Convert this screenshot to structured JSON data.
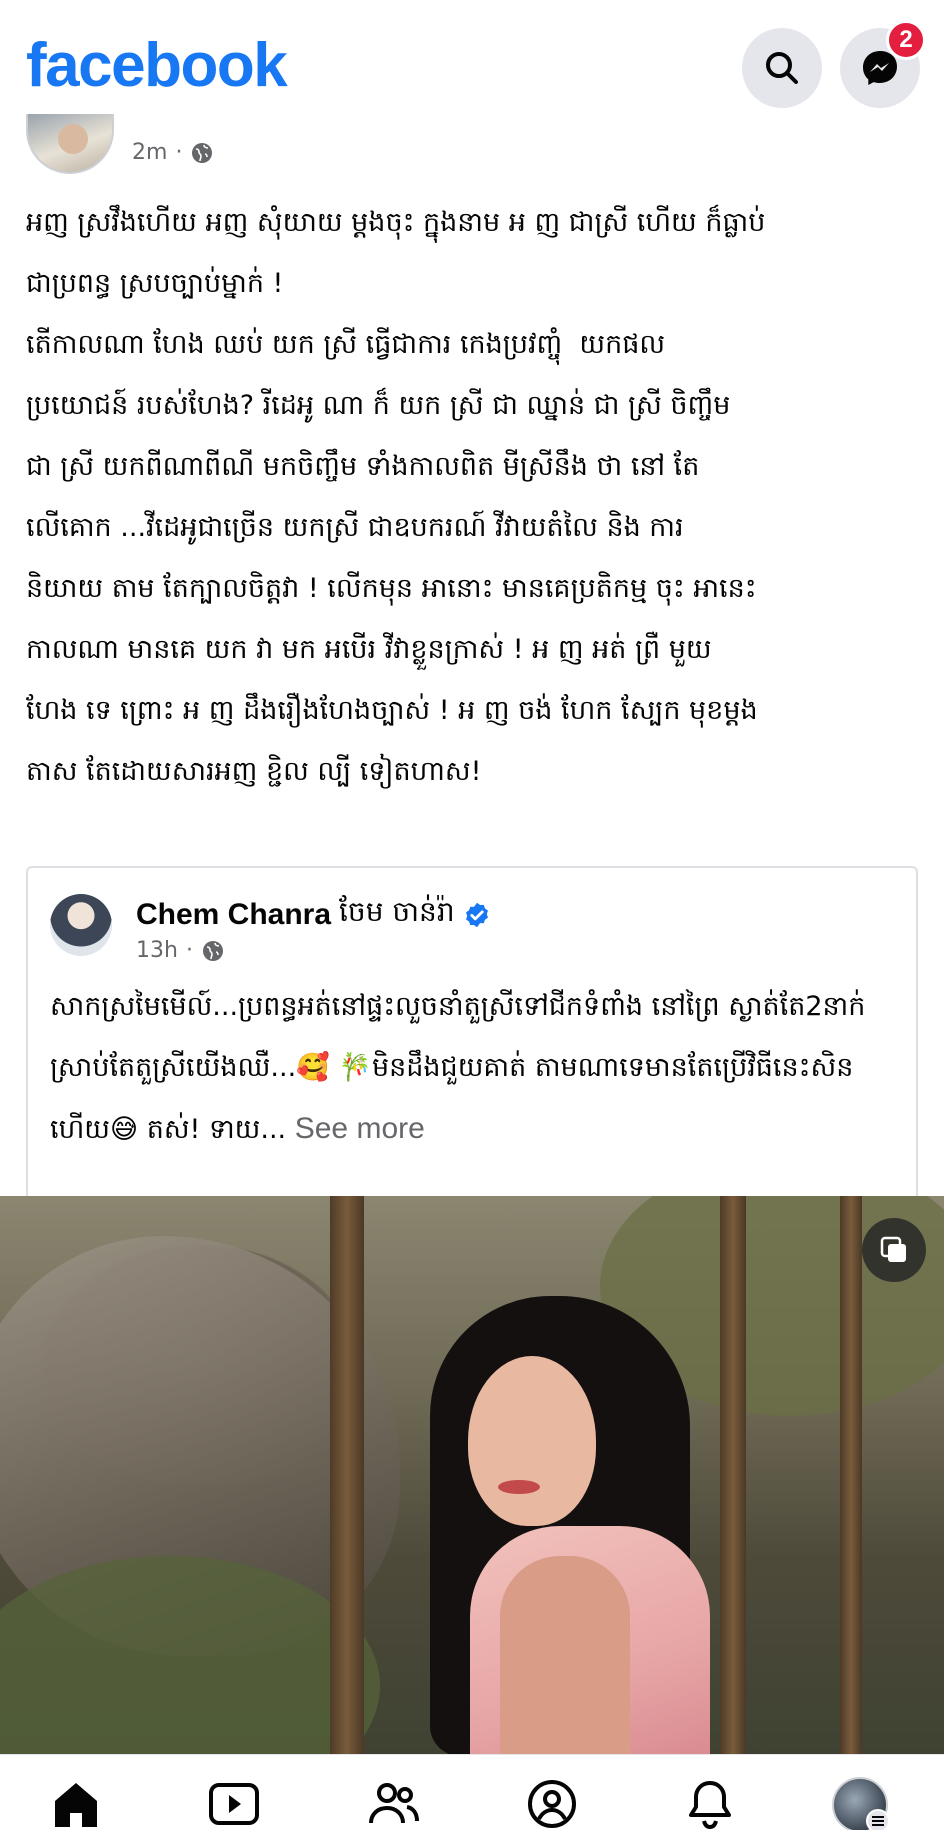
{
  "header": {
    "logo": "facebook",
    "messenger_badge": "2"
  },
  "post": {
    "time": "2m",
    "text": "អញ ស្រវឹងហើយ អញ សុំយាយ ម្តងចុះ ក្នុងនាម អ ញ ជាស្រី ហើយ ក៏ធ្លាប់\nជាប្រពន្ធ ស្របច្បាប់ម្នាក់ !\nតើកាលណា ហែង ឈប់ យក ស្រី ធ្វើជាការ កេងប្រវញ្ចុំ  យកផល\nប្រយោជន៍ របស់ហែង? រីដេអូ ណា ក៏ យក ស្រី ជា ឈ្នាន់ ជា ស្រី ចិញ្ចឹម\nជា ស្រី យកពីណាពីណី មកចិញ្ចឹម ទាំងកាលពិត មីស្រីនឹង ថា នៅ តែ\nលើគោក ...វីដេអូជាច្រើន យកស្រី ជាឧបករណ៍ វីវាយតំលៃ និង ការ\nនិយាយ តាម តែក្បាលចិត្តវា ! លើកមុន អានោះ មានគេប្រតិកម្ម ចុះ អានេះ\nកាលណា មានគេ យក វា មក អបើរ វីវាខ្លួនក្រាស់ ! អ ញ អត់ ព្រឺ មួយ\nហែង ទេ ព្រោះ អ ញ ដឹងរឿងហែងច្បាស់ ! អ ញ ចង់ ហែក ស្បែក មុខម្តង\nតាស តែដោយសារអញ ខ្ជិល ល្បី ទៀតហាស!"
  },
  "shared_post": {
    "author": "Chem Chanra",
    "author_khmer": "ចែម ចាន់រ៉ា",
    "time": "13h",
    "text": "សាកស្រមៃមើល៍...ប្រពន្ធអត់នៅផ្ទះលួចនាំតួស្រីទៅជីកទំពាំង នៅព្រៃ ស្ងាត់តែ2នាក់ ស្រាប់តែតួស្រីយើងឈឺ...🥰 🎋មិនដឹងជួយគាត់ តាមណាទេមានតែប្រើវិធីនេះសិនហើយ😅 តស់! ទាយ...",
    "see_more": "See more"
  },
  "icons": {
    "search": "search-icon",
    "messenger": "messenger-icon",
    "globe": "globe-icon",
    "verified": "verified-badge-icon",
    "layers": "multiple-images-icon",
    "home": "home-icon",
    "video": "video-icon",
    "friends": "friends-icon",
    "profile": "profile-icon",
    "notifications": "bell-icon",
    "menu": "menu-avatar"
  },
  "colors": {
    "brand": "#1877F2",
    "badge": "#e41e3f",
    "secondary_text": "#65676b",
    "button_bg": "#e4e6eb"
  }
}
